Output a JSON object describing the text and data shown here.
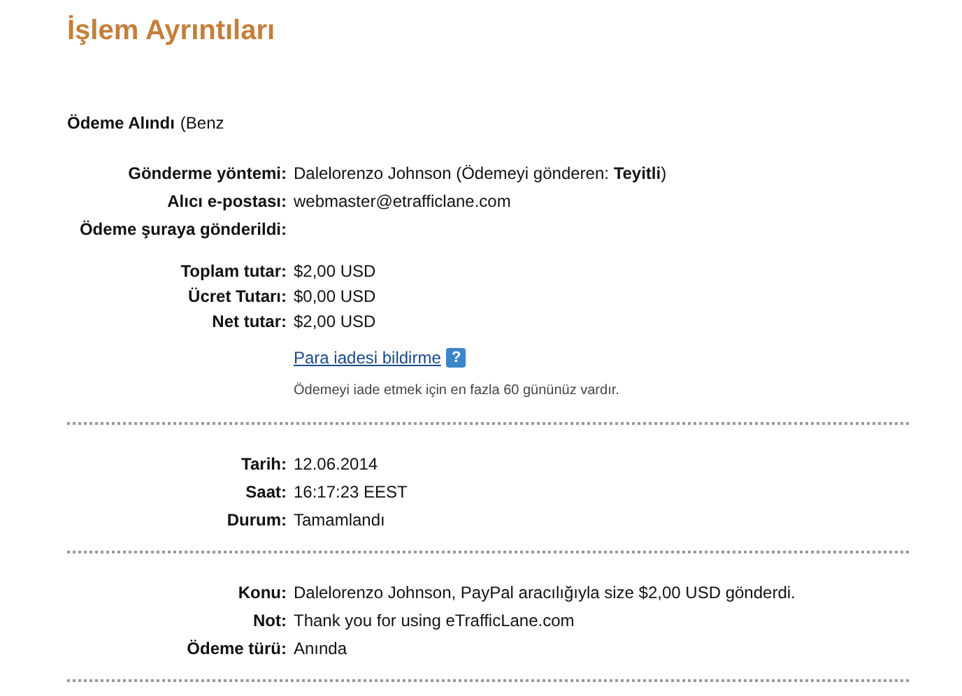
{
  "title": "İşlem Ayrıntıları",
  "payment": {
    "label": "Ödeme Alındı",
    "detail": "(Benz"
  },
  "details": [
    {
      "label": "Gönderme yöntemi:",
      "value": "Dalelorenzo Johnson (Ödemeyi gönderen: **Teyitli**)"
    },
    {
      "label": "Alıcı e-postası:",
      "value": "webmaster@etrafficlane.com"
    },
    {
      "label": "Ödeme şuraya gönderildi:"
    }
  ],
  "amounts": [
    {
      "label": "Toplam tutar:",
      "value": "$2,00 USD"
    },
    {
      "label": "Ücret Tutarı:",
      "value": "$0,00 USD"
    },
    {
      "label": "Net tutar:",
      "value": "$2,00 USD"
    }
  ],
  "refund": {
    "link": "Para iadesi bildirme",
    "help": "?",
    "note": "Ödemeyi iade etmek için en fazla 60 gününüz vardır."
  },
  "dates": [
    {
      "label": "Tarih:",
      "value": "12.06.2014"
    },
    {
      "label": "Saat:",
      "value": "16:17:23 EEST"
    },
    {
      "label": "Durum:",
      "value": "Tamamlandı"
    }
  ],
  "message": [
    {
      "label": "Konu:",
      "value": "Dalelorenzo Johnson, PayPal aracılığıyla size $2,00 USD gönderdi."
    },
    {
      "label": "Not:",
      "value": "Thank you for using eTrafficLane.com"
    },
    {
      "label": "Ödeme türü:",
      "value": "Anında"
    }
  ]
}
